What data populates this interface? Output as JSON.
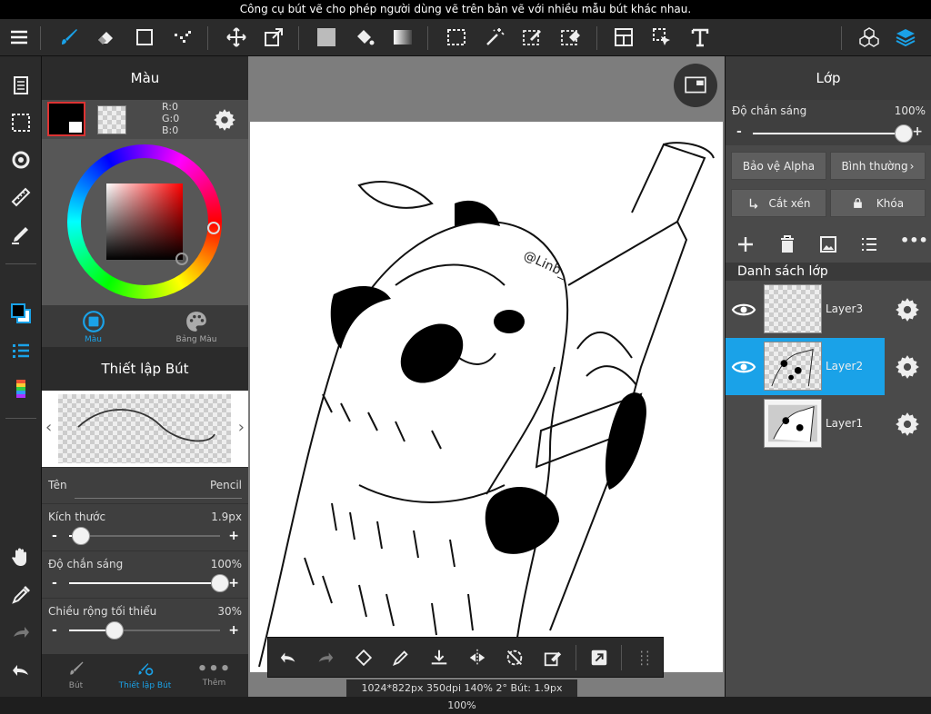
{
  "hint": "Công cụ bút vẽ cho phép người dùng vẽ trên bản vẽ với nhiều mẫu bút khác nhau.",
  "color_panel": {
    "title": "Màu",
    "rgb": {
      "r": "R:0",
      "g": "G:0",
      "b": "B:0"
    },
    "tab_color": "Màu",
    "tab_palette": "Bảng Màu",
    "accent": "#1aa2e8",
    "fg_color": "#000000"
  },
  "brush_panel": {
    "title": "Thiết lập Bút",
    "name_label": "Tên",
    "name_value": "Pencil",
    "size_label": "Kích thước",
    "size_value": "1.9px",
    "size_level": 0.08,
    "opacity_label": "Độ chắn sáng",
    "opacity_value": "100%",
    "opacity_level": 1.0,
    "minwidth_label": "Chiều rộng tối thiểu",
    "minwidth_value": "30%",
    "minwidth_level": 0.3
  },
  "bottom_tabs": {
    "brush": "Bút",
    "brush_settings": "Thiết lập Bút",
    "more": "Thêm"
  },
  "status": "1024*822px 350dpi 140% 2° Bút: 1.9px 100%",
  "canvas": {
    "signature": "@Linb_"
  },
  "layers": {
    "title": "Lớp",
    "opacity_label": "Độ chắn sáng",
    "opacity_value": "100%",
    "opacity_level": 1.0,
    "protect_alpha": "Bảo vệ Alpha",
    "blend_mode": "Bình thường",
    "clipping": "Cắt xén",
    "lock": "Khóa",
    "list_title": "Danh sách lớp",
    "items": [
      {
        "name": "Layer3",
        "visible": true,
        "selected": false
      },
      {
        "name": "Layer2",
        "visible": true,
        "selected": true
      },
      {
        "name": "Layer1",
        "visible": false,
        "selected": false
      }
    ]
  }
}
